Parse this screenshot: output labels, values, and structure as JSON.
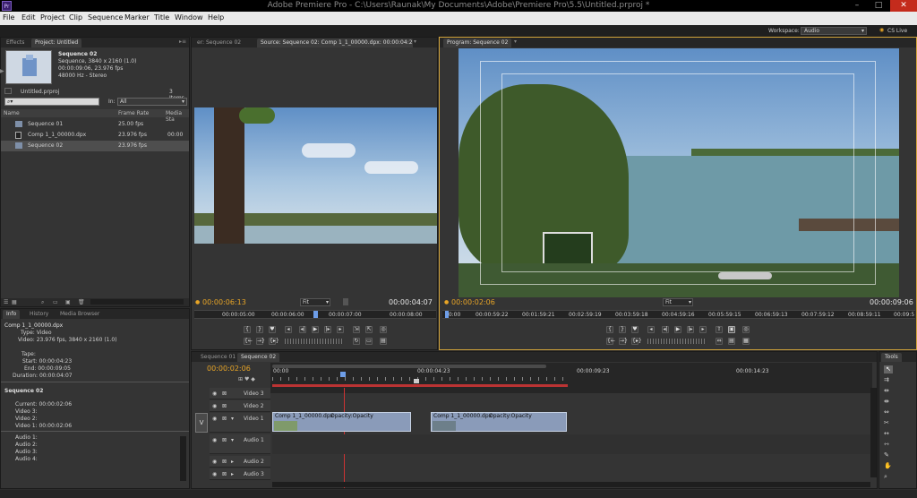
{
  "window": {
    "title": "Adobe Premiere Pro - C:\\Users\\Raunak\\My Documents\\Adobe\\Premiere Pro\\5.5\\Untitled.prproj *",
    "app_icon": "Pr"
  },
  "menu": [
    "File",
    "Edit",
    "Project",
    "Clip",
    "Sequence",
    "Marker",
    "Title",
    "Window",
    "Help"
  ],
  "workspace": {
    "label": "Workspace:",
    "value": "Audio",
    "cs_live": "CS Live"
  },
  "project": {
    "tabs": [
      "Effects",
      "Project: Untitled"
    ],
    "preview": {
      "name": "Sequence 02",
      "line1": "Sequence, 3840 x 2160 (1.0)",
      "line2": "00:00:09:06, 23.976 fps",
      "line3": "48000 Hz - Stereo"
    },
    "file": "Untitled.prproj",
    "count": "3 Items",
    "in_label": "In:",
    "in_value": "All",
    "columns": [
      "Name",
      "Frame Rate",
      "Media Sta"
    ],
    "rows": [
      {
        "name": "Sequence 01",
        "rate": "25.00 fps",
        "extra": ""
      },
      {
        "name": "Comp 1_1_00000.dpx",
        "rate": "23.976 fps",
        "extra": "00:00"
      },
      {
        "name": "Sequence 02",
        "rate": "23.976 fps",
        "extra": ""
      }
    ]
  },
  "info": {
    "tabs": [
      "Info",
      "History",
      "Media Browser"
    ],
    "clip_name": "Comp 1_1_00000.dpx",
    "type": "Type: Video",
    "video": "Video: 23.976 fps, 3840 x 2160 (1.0)",
    "tape": "Tape:",
    "start": "Start: 00:00:04:23",
    "end": "End: 00:00:09:05",
    "duration": "Duration: 00:00:04:07",
    "seq_name": "Sequence 02",
    "current": "Current: 00:00:02:06",
    "v3": "Video 3:",
    "v2": "Video 2:",
    "v1": "Video 1: 00:00:02:06",
    "a1": "Audio 1:",
    "a2": "Audio 2:",
    "a3": "Audio 3:",
    "a4": "Audio 4:"
  },
  "source": {
    "tabs": [
      "er: Sequence 02",
      "Source: Sequence 02: Comp 1_1_00000.dpx: 00:00:04:23"
    ],
    "timecode": "00:00:06:13",
    "fit": "Fit",
    "duration": "00:00:04:07",
    "ruler": [
      "00:00:05:00",
      "00:00:06:00",
      "00:00:07:00",
      "00:00:08:00"
    ]
  },
  "program": {
    "tab": "Program: Sequence 02",
    "timecode": "00:00:02:06",
    "fit": "Fit",
    "duration": "00:00:09:06",
    "ruler": [
      "00:00",
      "00:00:59:22",
      "00:01:59:21",
      "00:02:59:19",
      "00:03:59:18",
      "00:04:59:16",
      "00:05:59:15",
      "00:06:59:13",
      "00:07:59:12",
      "00:08:59:11",
      "00:09:5"
    ]
  },
  "timeline": {
    "tabs": [
      "Sequence 01",
      "Sequence 02"
    ],
    "timecode": "00:00:02:06",
    "ruler": [
      "00:00",
      "00:00:04:23",
      "00:00:09:23",
      "00:00:14:23"
    ],
    "tracks": [
      "Video 3",
      "Video 2",
      "Video 1",
      "Audio 1",
      "Audio 2",
      "Audio 3"
    ],
    "v_label": "V",
    "clips": [
      {
        "name": "Comp 1_1_00000.dpx",
        "fx": "Opacity:Opacity"
      },
      {
        "name": "Comp 1_1_00000.dpx",
        "fx": "Opacity:Opacity"
      }
    ]
  },
  "tools": {
    "title": "Tools"
  }
}
